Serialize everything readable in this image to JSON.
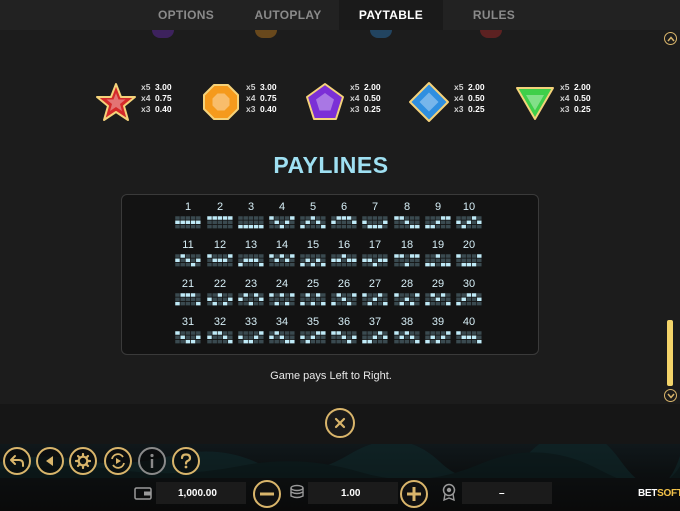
{
  "tabs": [
    {
      "label": "OPTIONS",
      "active": false
    },
    {
      "label": "AUTOPLAY",
      "active": false
    },
    {
      "label": "PAYTABLE",
      "active": true
    },
    {
      "label": "RULES",
      "active": false
    }
  ],
  "symbols": [
    {
      "icon": "red-star-gem-icon",
      "color": "#d42a2a",
      "pays": [
        {
          "mult": "x5",
          "value": "3.00"
        },
        {
          "mult": "x4",
          "value": "0.75"
        },
        {
          "mult": "x3",
          "value": "0.40"
        }
      ]
    },
    {
      "icon": "orange-octagon-gem-icon",
      "color": "#f59a1c",
      "pays": [
        {
          "mult": "x5",
          "value": "3.00"
        },
        {
          "mult": "x4",
          "value": "0.75"
        },
        {
          "mult": "x3",
          "value": "0.40"
        }
      ]
    },
    {
      "icon": "purple-pentagon-gem-icon",
      "color": "#7b2fd6",
      "pays": [
        {
          "mult": "x5",
          "value": "2.00"
        },
        {
          "mult": "x4",
          "value": "0.50"
        },
        {
          "mult": "x3",
          "value": "0.25"
        }
      ]
    },
    {
      "icon": "blue-diamond-gem-icon",
      "color": "#2f8fe0",
      "pays": [
        {
          "mult": "x5",
          "value": "2.00"
        },
        {
          "mult": "x4",
          "value": "0.50"
        },
        {
          "mult": "x3",
          "value": "0.25"
        }
      ]
    },
    {
      "icon": "green-triangle-gem-icon",
      "color": "#3fcf4a",
      "pays": [
        {
          "mult": "x5",
          "value": "2.00"
        },
        {
          "mult": "x4",
          "value": "0.50"
        },
        {
          "mult": "x3",
          "value": "0.25"
        }
      ]
    }
  ],
  "paylines_title": "PAYLINES",
  "paylines": [
    {
      "n": "1",
      "rows": [
        1,
        1,
        1,
        1,
        1
      ]
    },
    {
      "n": "2",
      "rows": [
        0,
        0,
        0,
        0,
        0
      ]
    },
    {
      "n": "3",
      "rows": [
        2,
        2,
        2,
        2,
        2
      ]
    },
    {
      "n": "4",
      "rows": [
        0,
        1,
        2,
        1,
        0
      ]
    },
    {
      "n": "5",
      "rows": [
        2,
        1,
        0,
        1,
        2
      ]
    },
    {
      "n": "6",
      "rows": [
        1,
        0,
        0,
        0,
        1
      ]
    },
    {
      "n": "7",
      "rows": [
        1,
        2,
        2,
        2,
        1
      ]
    },
    {
      "n": "8",
      "rows": [
        0,
        0,
        1,
        2,
        2
      ]
    },
    {
      "n": "9",
      "rows": [
        2,
        2,
        1,
        0,
        0
      ]
    },
    {
      "n": "10",
      "rows": [
        1,
        2,
        1,
        0,
        1
      ]
    },
    {
      "n": "11",
      "rows": [
        1,
        0,
        1,
        2,
        1
      ]
    },
    {
      "n": "12",
      "rows": [
        0,
        1,
        1,
        1,
        0
      ]
    },
    {
      "n": "13",
      "rows": [
        2,
        1,
        1,
        1,
        2
      ]
    },
    {
      "n": "14",
      "rows": [
        0,
        1,
        0,
        1,
        0
      ]
    },
    {
      "n": "15",
      "rows": [
        2,
        1,
        2,
        1,
        2
      ]
    },
    {
      "n": "16",
      "rows": [
        1,
        1,
        0,
        1,
        1
      ]
    },
    {
      "n": "17",
      "rows": [
        1,
        1,
        2,
        1,
        1
      ]
    },
    {
      "n": "18",
      "rows": [
        0,
        0,
        2,
        0,
        0
      ]
    },
    {
      "n": "19",
      "rows": [
        2,
        2,
        0,
        2,
        2
      ]
    },
    {
      "n": "20",
      "rows": [
        0,
        2,
        2,
        2,
        0
      ]
    },
    {
      "n": "21",
      "rows": [
        2,
        0,
        0,
        0,
        2
      ]
    },
    {
      "n": "22",
      "rows": [
        1,
        2,
        0,
        2,
        1
      ]
    },
    {
      "n": "23",
      "rows": [
        1,
        0,
        2,
        0,
        1
      ]
    },
    {
      "n": "24",
      "rows": [
        0,
        2,
        0,
        2,
        0
      ]
    },
    {
      "n": "25",
      "rows": [
        2,
        0,
        2,
        0,
        2
      ]
    },
    {
      "n": "26",
      "rows": [
        2,
        0,
        1,
        2,
        0
      ]
    },
    {
      "n": "27",
      "rows": [
        0,
        2,
        1,
        0,
        2
      ]
    },
    {
      "n": "28",
      "rows": [
        0,
        2,
        1,
        2,
        0
      ]
    },
    {
      "n": "29",
      "rows": [
        2,
        0,
        1,
        0,
        2
      ]
    },
    {
      "n": "30",
      "rows": [
        2,
        1,
        0,
        0,
        1
      ]
    },
    {
      "n": "31",
      "rows": [
        0,
        1,
        2,
        2,
        1
      ]
    },
    {
      "n": "32",
      "rows": [
        1,
        0,
        0,
        1,
        2
      ]
    },
    {
      "n": "33",
      "rows": [
        1,
        2,
        2,
        1,
        0
      ]
    },
    {
      "n": "34",
      "rows": [
        1,
        0,
        1,
        2,
        2
      ]
    },
    {
      "n": "35",
      "rows": [
        1,
        2,
        1,
        0,
        0
      ]
    },
    {
      "n": "36",
      "rows": [
        0,
        0,
        1,
        2,
        1
      ]
    },
    {
      "n": "37",
      "rows": [
        2,
        2,
        1,
        0,
        1
      ]
    },
    {
      "n": "38",
      "rows": [
        0,
        1,
        0,
        1,
        2
      ]
    },
    {
      "n": "39",
      "rows": [
        2,
        1,
        2,
        1,
        0
      ]
    },
    {
      "n": "40",
      "rows": [
        0,
        1,
        1,
        1,
        2
      ]
    }
  ],
  "pays_note": "Game pays Left to Right.",
  "controls": {
    "balance": "1,000.00",
    "bet": "1.00",
    "win": "–"
  },
  "logo": {
    "part1": "BET",
    "part2": "SOFT"
  },
  "accent_gold": "#d9b56b"
}
